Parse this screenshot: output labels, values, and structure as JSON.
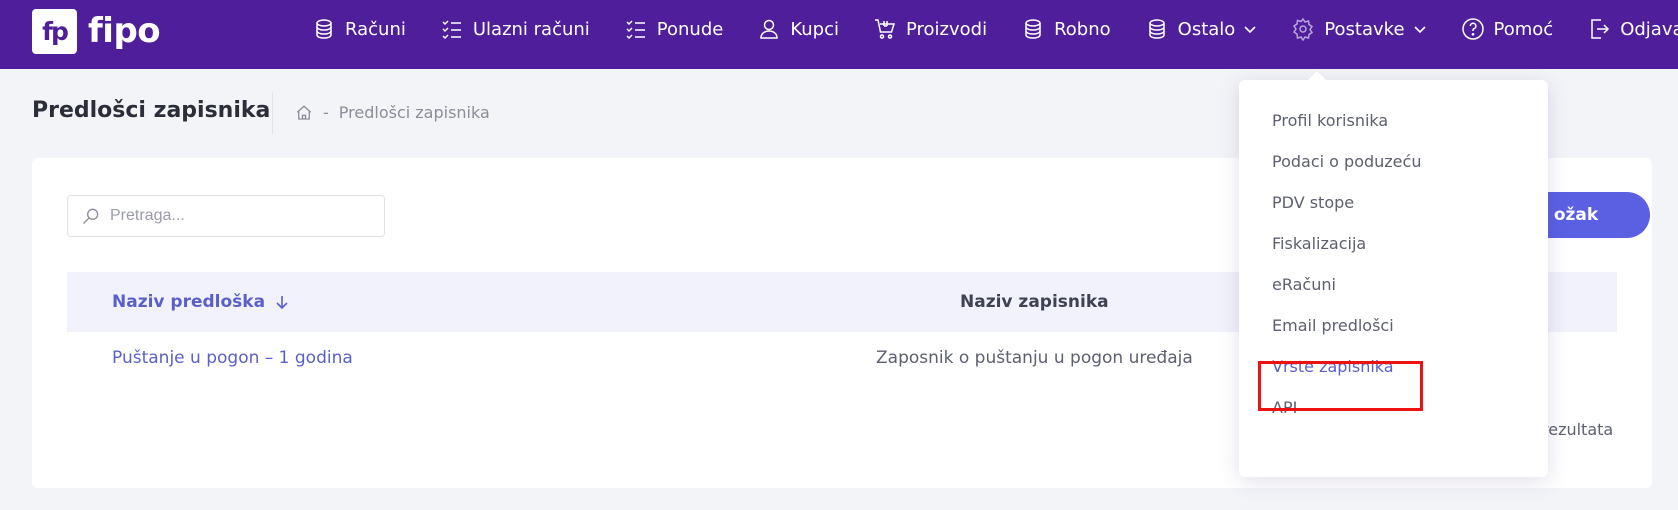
{
  "brand": {
    "logo_mark": "fp",
    "name": "fipo",
    "color": "#4f1f9b"
  },
  "nav": [
    {
      "label": "Računi",
      "icon": "coins-icon"
    },
    {
      "label": "Ulazni računi",
      "icon": "checklist-icon"
    },
    {
      "label": "Ponude",
      "icon": "checklist-icon"
    },
    {
      "label": "Kupci",
      "icon": "user-icon"
    },
    {
      "label": "Proizvodi",
      "icon": "cart-icon"
    },
    {
      "label": "Robno",
      "icon": "coins-icon"
    },
    {
      "label": "Ostalo",
      "icon": "coins-icon",
      "has_dropdown": true
    },
    {
      "label": "Postavke",
      "icon": "gear-icon",
      "has_dropdown": true,
      "active": true
    },
    {
      "label": "Pomoć",
      "icon": "help-icon"
    },
    {
      "label": "Odjava",
      "icon": "logout-icon"
    }
  ],
  "page": {
    "title": "Predlošci zapisnika",
    "breadcrumb": {
      "separator": "-",
      "current": "Predlošci zapisnika"
    }
  },
  "search": {
    "placeholder": "Pretraga..."
  },
  "add_button": {
    "label": "ožak"
  },
  "table": {
    "columns": [
      "Naziv predloška",
      "Naziv zapisnika"
    ],
    "sort": {
      "column": "Naziv predloška",
      "direction": "desc"
    },
    "rows": [
      {
        "naziv_predloska": "Puštanje u pogon – 1 godina",
        "naziv_zapisnika": "Zaposnik o puštanju u pogon uređaja"
      }
    ],
    "results_text": "rezultata"
  },
  "dropdown": {
    "items": [
      {
        "label": "Profil korisnika"
      },
      {
        "label": "Podaci o poduzeću"
      },
      {
        "label": "PDV stope"
      },
      {
        "label": "Fiskalizacija"
      },
      {
        "label": "eRačuni"
      },
      {
        "label": "Email predlošci"
      },
      {
        "label": "Vrste zapisnika",
        "active": true,
        "highlighted": true
      },
      {
        "label": "API"
      }
    ]
  },
  "colors": {
    "accent": "#5b60c9",
    "button": "#5b60e3",
    "highlight": "#ee1111"
  }
}
